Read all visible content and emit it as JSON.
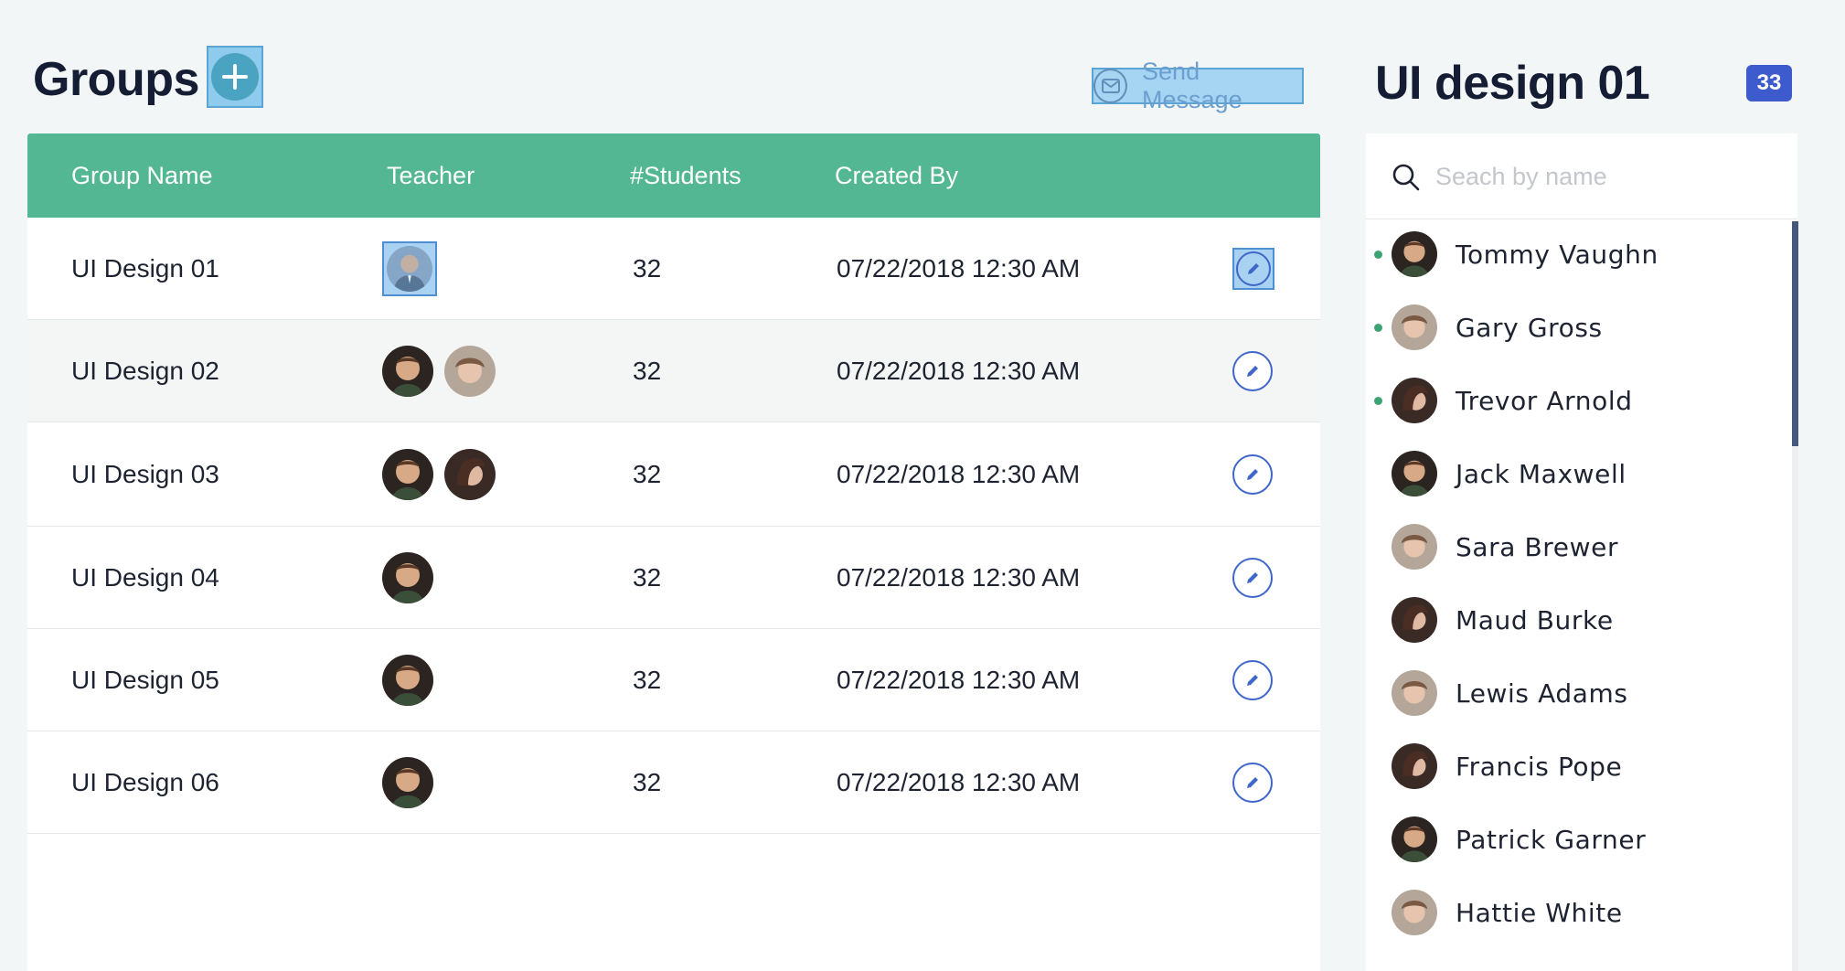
{
  "header": {
    "title": "Groups",
    "send_message_label": "Send Message"
  },
  "table": {
    "columns": [
      "Group Name",
      "Teacher",
      "#Students",
      "Created By"
    ],
    "rows": [
      {
        "name": "UI Design 01",
        "students": "32",
        "created": "07/22/2018 12:30 AM"
      },
      {
        "name": "UI Design 02",
        "students": "32",
        "created": "07/22/2018 12:30 AM"
      },
      {
        "name": "UI Design 03",
        "students": "32",
        "created": "07/22/2018 12:30 AM"
      },
      {
        "name": "UI Design 04",
        "students": "32",
        "created": "07/22/2018 12:30 AM"
      },
      {
        "name": "UI Design 05",
        "students": "32",
        "created": "07/22/2018 12:30 AM"
      },
      {
        "name": "UI Design 06",
        "students": "32",
        "created": "07/22/2018 12:30 AM"
      }
    ]
  },
  "panel": {
    "title": "UI design 01",
    "count": "33",
    "search_placeholder": "Seach by name",
    "members": [
      {
        "name": "Tommy Vaughn",
        "online": true
      },
      {
        "name": "Gary Gross",
        "online": true
      },
      {
        "name": "Trevor Arnold",
        "online": true
      },
      {
        "name": "Jack Maxwell",
        "online": false
      },
      {
        "name": "Sara Brewer",
        "online": false
      },
      {
        "name": "Maud Burke",
        "online": false
      },
      {
        "name": "Lewis Adams",
        "online": false
      },
      {
        "name": "Francis Pope",
        "online": false
      },
      {
        "name": "Patrick Garner",
        "online": false
      },
      {
        "name": "Hattie White",
        "online": false
      }
    ]
  },
  "colors": {
    "header_green": "#53b794",
    "accent_blue": "#3d5bcc",
    "online_green": "#3ea274"
  },
  "icons": [
    "plus-icon",
    "mail-icon",
    "pencil-icon",
    "search-icon"
  ]
}
